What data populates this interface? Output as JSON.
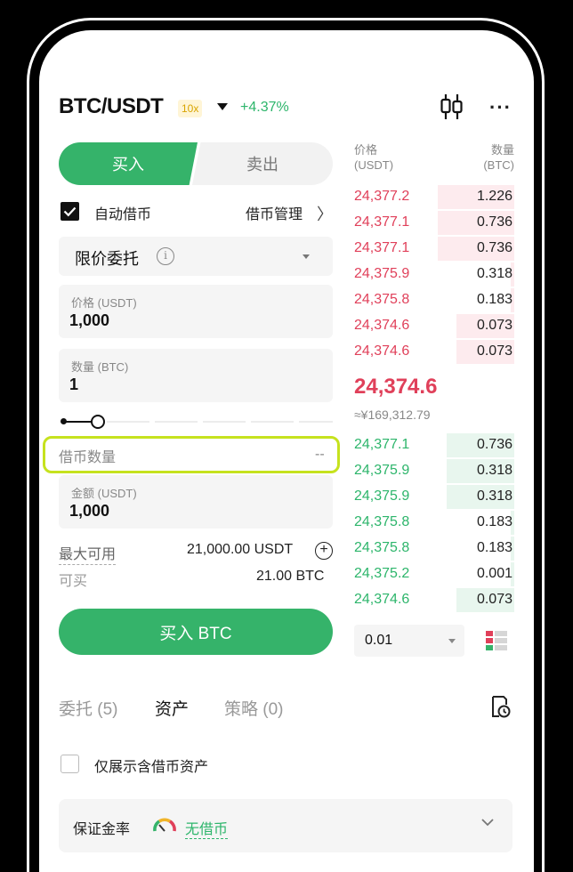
{
  "header": {
    "pair": "BTC/USDT",
    "leverage": "10x",
    "change": "+4.37%",
    "icons": {
      "chart": "candlestick-icon",
      "more": "more-icon"
    },
    "more_glyph": "···"
  },
  "trade": {
    "buy_tab": "买入",
    "sell_tab": "卖出",
    "auto_borrow": "自动借币",
    "auto_borrow_checked": true,
    "borrow_management": "借币管理",
    "borrow_management_chevron": "〉",
    "order_type": "限价委托",
    "info_glyph": "i",
    "price_label": "价格 (USDT)",
    "price_value": "1,000",
    "amount_label": "数量 (BTC)",
    "amount_value": "1",
    "slider_fraction": 0.1,
    "borrow_qty_label": "借币数量",
    "borrow_qty_value": "--",
    "total_label": "金额 (USDT)",
    "total_value": "1,000",
    "max_available_label": "最大可用",
    "max_available_value": "21,000.00 USDT",
    "plus_glyph": "+",
    "can_buy_label": "可买",
    "can_buy_value": "21.00 BTC",
    "buy_button": "买入 BTC"
  },
  "orderbook": {
    "price_header": [
      "价格",
      "(USDT)"
    ],
    "qty_header": [
      "数量",
      "(BTC)"
    ],
    "asks": [
      {
        "price": "24,377.2",
        "qty": "1.226",
        "depth": 0.48
      },
      {
        "price": "24,377.1",
        "qty": "0.736",
        "depth": 0.48
      },
      {
        "price": "24,377.1",
        "qty": "0.736",
        "depth": 0.48
      },
      {
        "price": "24,375.9",
        "qty": "0.318",
        "depth": 0.02
      },
      {
        "price": "24,375.8",
        "qty": "0.183",
        "depth": 0.02
      },
      {
        "price": "24,374.6",
        "qty": "0.073",
        "depth": 0.36
      },
      {
        "price": "24,374.6",
        "qty": "0.073",
        "depth": 0.36
      }
    ],
    "mid_price": "24,374.6",
    "mid_cny": "≈¥169,312.79",
    "bids": [
      {
        "price": "24,377.1",
        "qty": "0.736",
        "depth": 0.42
      },
      {
        "price": "24,375.9",
        "qty": "0.318",
        "depth": 0.42
      },
      {
        "price": "24,375.9",
        "qty": "0.318",
        "depth": 0.42
      },
      {
        "price": "24,375.8",
        "qty": "0.183",
        "depth": 0.02
      },
      {
        "price": "24,375.8",
        "qty": "0.183",
        "depth": 0.02
      },
      {
        "price": "24,375.2",
        "qty": "0.001",
        "depth": 0.02
      },
      {
        "price": "24,374.6",
        "qty": "0.073",
        "depth": 0.36
      }
    ],
    "depth_step": "0.01"
  },
  "bottom": {
    "tabs": [
      {
        "label": "委托 (5)",
        "active": false
      },
      {
        "label": "资产",
        "active": true
      },
      {
        "label": "策略 (0)",
        "active": false
      }
    ],
    "only_show_borrowed": "仅展示含借币资产",
    "margin_ratio_label": "保证金率",
    "margin_status": "无借币"
  },
  "colors": {
    "green": "#35b36a",
    "red": "#e0405a",
    "ask_bar": "#fdebee",
    "bid_bar": "#e8f6ee",
    "highlight": "#c6e21e"
  }
}
